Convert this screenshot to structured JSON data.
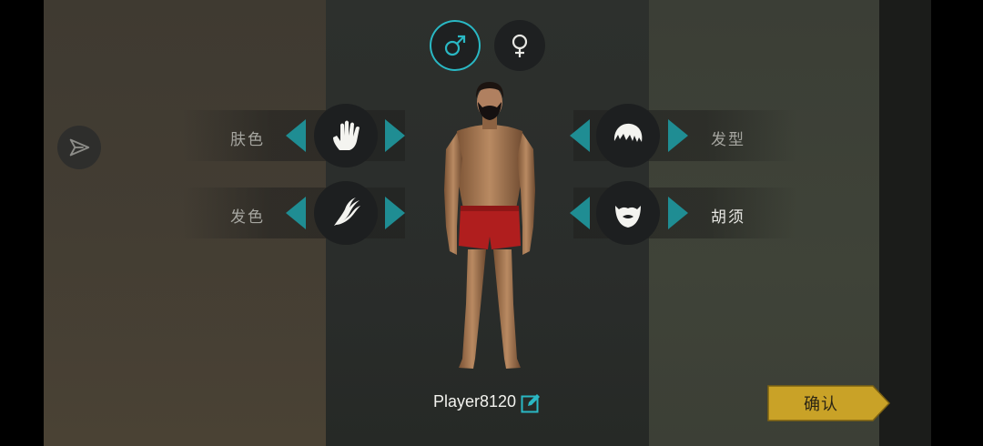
{
  "gender": {
    "male": {
      "icon": "male-symbol-icon",
      "selected": true
    },
    "female": {
      "icon": "female-symbol-icon",
      "selected": false
    }
  },
  "share": {
    "icon": "share-arrow-icon"
  },
  "options": {
    "skin_color": {
      "label": "肤色",
      "icon": "hand-icon"
    },
    "hair_color": {
      "label": "发色",
      "icon": "hair-strand-icon"
    },
    "hairstyle": {
      "label": "发型",
      "icon": "hair-icon"
    },
    "beard": {
      "label": "胡须",
      "icon": "beard-icon"
    }
  },
  "player": {
    "name": "Player8120",
    "edit_icon": "edit-pencil-icon"
  },
  "confirm": {
    "label": "确认"
  },
  "colors": {
    "accent_teal": "#2ab8c4",
    "arrow_teal": "#1f8d93",
    "confirm_gold": "#c9a227",
    "shorts_red": "#b01e1e"
  }
}
